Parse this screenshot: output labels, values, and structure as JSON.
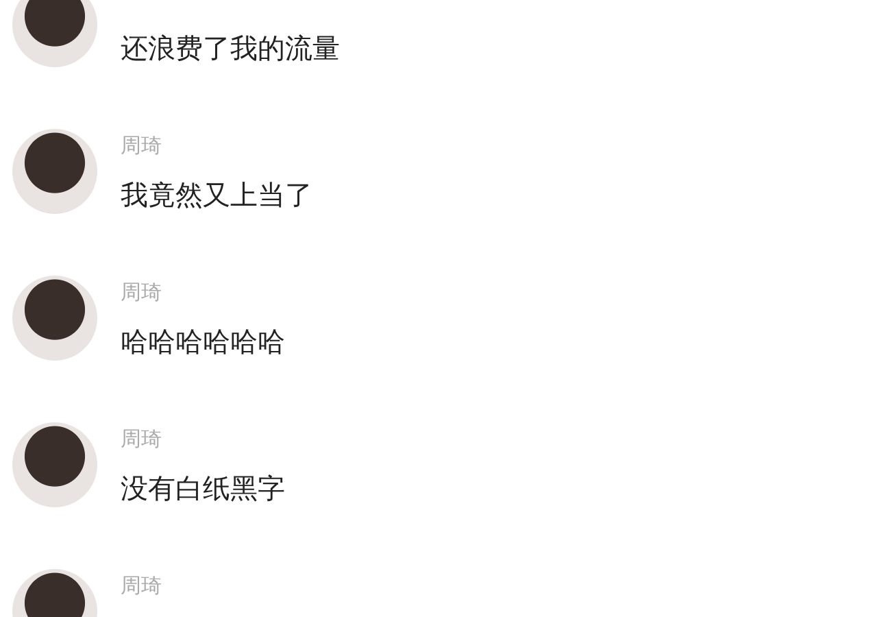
{
  "messages": [
    {
      "text": "还浪费了我的流量"
    },
    {
      "sender": "周琦",
      "text": "我竟然又上当了"
    },
    {
      "sender": "周琦",
      "text": "哈哈哈哈哈哈"
    },
    {
      "sender": "周琦",
      "text": "没有白纸黑字"
    },
    {
      "sender": "周琦"
    }
  ]
}
